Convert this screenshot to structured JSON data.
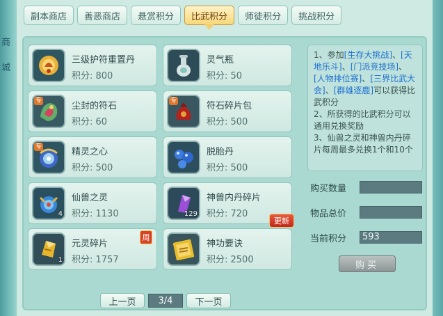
{
  "side": {
    "chars": [
      "商",
      "城"
    ]
  },
  "tabs": [
    {
      "label": "副本商店"
    },
    {
      "label": "善恶商店"
    },
    {
      "label": "悬赏积分"
    },
    {
      "label": "比武积分"
    },
    {
      "label": "师徒积分"
    },
    {
      "label": "挑战积分"
    }
  ],
  "items": [
    {
      "name": "三级护符重置丹",
      "price": "积分: 800",
      "icon": "amulet-pill-icon"
    },
    {
      "name": "灵气瓶",
      "price": "积分: 50",
      "icon": "vase-icon"
    },
    {
      "name": "尘封的符石",
      "price": "积分: 60",
      "icon": "rune-stone-icon",
      "tag": "专"
    },
    {
      "name": "符石碎片包",
      "price": "积分: 500",
      "icon": "fragment-bag-icon",
      "tag": "专"
    },
    {
      "name": "精灵之心",
      "price": "积分: 500",
      "icon": "spirit-heart-icon",
      "tag": "专"
    },
    {
      "name": "脱胎丹",
      "price": "积分: 500",
      "icon": "blue-pills-icon"
    },
    {
      "name": "仙兽之灵",
      "price": "积分: 1130",
      "icon": "beast-spirit-icon",
      "qty": "4"
    },
    {
      "name": "神兽内丹碎片",
      "price": "积分: 720",
      "icon": "crystal-shard-icon",
      "qty": "129",
      "badge": "更新"
    },
    {
      "name": "元灵碎片",
      "price": "积分: 1757",
      "icon": "gold-shard-icon",
      "qty": "1",
      "badge": "周"
    },
    {
      "name": "神功要诀",
      "price": "积分: 2500",
      "icon": "book-icon"
    }
  ],
  "info": {
    "l1a": "1、参加",
    "l1b": "[生存大挑战]",
    "l1c": "、",
    "l1d": "[天地乐斗]",
    "l1e": "、",
    "l1f": "[门派竞技场]",
    "l1g": "、",
    "l1h": "[人物排位赛]",
    "l1i": "、",
    "l1j": "[三界比武大会]",
    "l1k": "、",
    "l1l": "[群雄逐鹿]",
    "l1m": "可以获得比武积分",
    "l2": "2、所获得的比武积分可以通用兑换奖励",
    "l3": "3、仙兽之灵和神兽内丹碎片每周最多兑换1个和10个"
  },
  "form": {
    "qty_label": "购买数量",
    "qty_value": "",
    "total_label": "物品总价",
    "total_value": "",
    "points_label": "当前积分",
    "points_value": "593",
    "buy_label": "购买"
  },
  "pager": {
    "prev": "上一页",
    "page": "3/4",
    "next": "下一页"
  },
  "colors": {
    "accent_tab": "#f6d77a",
    "link": "#1e6fd0",
    "new_badge": "#c0281b"
  }
}
